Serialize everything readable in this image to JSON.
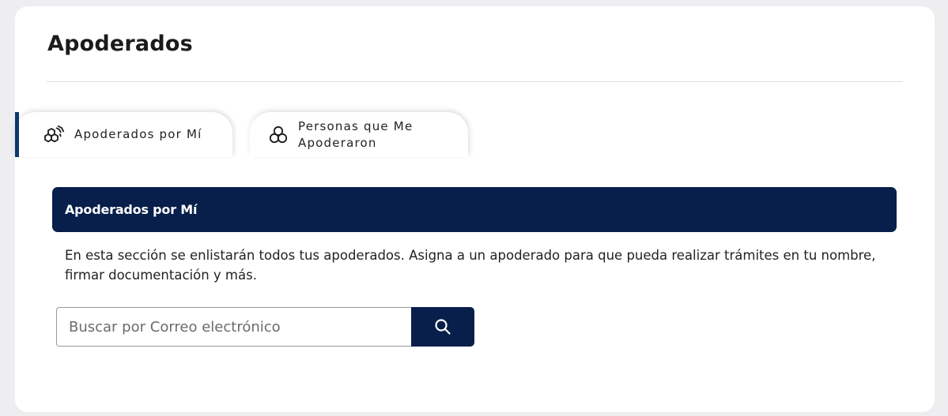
{
  "page": {
    "title": "Apoderados"
  },
  "tabs": [
    {
      "label": "Apoderados por Mí",
      "icon": "hexagon-cluster-icon",
      "active": true
    },
    {
      "label": "Personas que Me Apoderaron",
      "icon": "circles-cluster-icon",
      "active": false
    }
  ],
  "section": {
    "title": "Apoderados por Mí",
    "description": "En esta sección se enlistarán todos tus apoderados. Asigna a un apoderado para que pueda realizar trámites en tu nombre, firmar documentación y más."
  },
  "search": {
    "placeholder": "Buscar por Correo electrónico",
    "value": "",
    "button_icon": "search-icon"
  },
  "colors": {
    "primary": "#071f4a",
    "tab_accent": "#0a3a6b",
    "background": "#eeeef0"
  }
}
